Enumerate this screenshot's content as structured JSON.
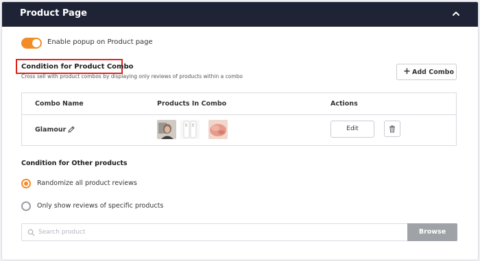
{
  "header": {
    "title": "Product Page",
    "collapse_icon": "chevron-up-icon"
  },
  "popup": {
    "enabled": true,
    "label": "Enable popup on Product page",
    "accent": "#f28c28"
  },
  "combo_section": {
    "title": "Condition for Product Combo",
    "subtitle": "Cross sell with product combos by displaying only reviews of products within a combo",
    "add_button_label": "Add Combo",
    "highlight_color": "#e0201a"
  },
  "combo_table": {
    "columns": [
      "Combo Name",
      "Products In Combo",
      "Actions"
    ],
    "rows": [
      {
        "name": "Glamour",
        "products": [
          "product-thumbnail-1",
          "product-thumbnail-2",
          "product-thumbnail-3"
        ],
        "edit_label": "Edit",
        "delete_icon": "trash-icon"
      }
    ]
  },
  "other_section": {
    "title": "Condition for Other products",
    "options": [
      {
        "label": "Randomize all product reviews",
        "selected": true
      },
      {
        "label": "Only show reviews of specific products",
        "selected": false
      }
    ]
  },
  "search": {
    "placeholder": "Search product",
    "value": "",
    "button_label": "Browse"
  },
  "colors": {
    "header_bg": "#1f2336",
    "accent": "#f28c28",
    "browse_bg": "#9fa2a7"
  }
}
